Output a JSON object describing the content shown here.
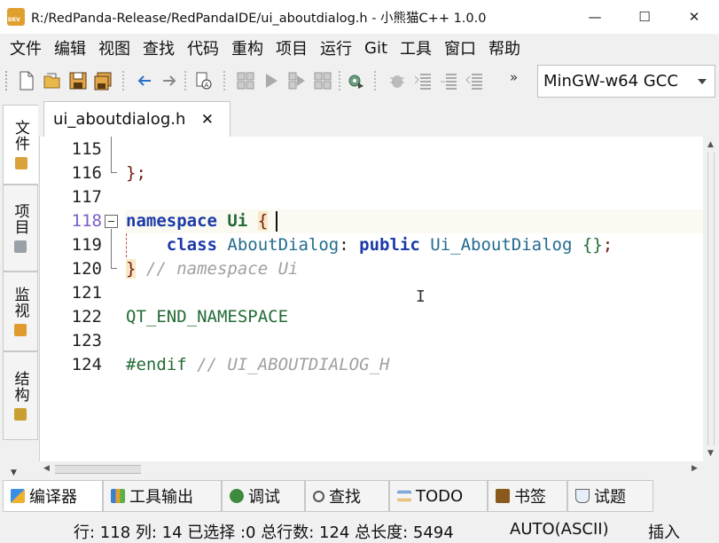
{
  "window": {
    "title": "R:/RedPanda-Release/RedPandaIDE/ui_aboutdialog.h - 小熊猫C++ 1.0.0",
    "minimize_glyph": "—",
    "maximize_glyph": "☐",
    "close_glyph": "✕"
  },
  "menu": [
    "文件",
    "编辑",
    "视图",
    "查找",
    "代码",
    "重构",
    "项目",
    "运行",
    "Git",
    "工具",
    "窗口",
    "帮助"
  ],
  "toolbar": {
    "overflow_glyph": "»",
    "compiler_selected": "MinGW-w64 GCC"
  },
  "left_tabs": [
    "文件",
    "项目",
    "监视",
    "结构"
  ],
  "editor": {
    "tab_label": "ui_aboutdialog.h",
    "tab_close_glyph": "✕",
    "lines": [
      {
        "num": "115"
      },
      {
        "num": "116",
        "brace": "}",
        "semi": ";"
      },
      {
        "num": "117"
      },
      {
        "num": "118",
        "kw": "namespace",
        "name": "Ui",
        "open": "{"
      },
      {
        "num": "119",
        "kw_class": "class",
        "cls": "AboutDialog",
        "colon": ":",
        "kw_public": "public",
        "base": "Ui_AboutDialog",
        "body": "{}",
        "semi": ";"
      },
      {
        "num": "120",
        "close": "}",
        "comment": "// namespace Ui"
      },
      {
        "num": "121"
      },
      {
        "num": "122",
        "macro": "QT_END_NAMESPACE"
      },
      {
        "num": "123"
      },
      {
        "num": "124",
        "directive": "#endif",
        "comment": "// UI_ABOUTDIALOG_H"
      }
    ]
  },
  "bottom_tabs": [
    "编译器",
    "工具输出",
    "调试",
    "查找",
    "TODO",
    "书签",
    "试题"
  ],
  "status": {
    "position": "行: 118 列: 14 已选择 :0 总行数: 124 总长度: 5494",
    "encoding": "AUTO(ASCII)",
    "mode": "插入"
  },
  "colors": {
    "keyword": "#1c3aa9",
    "namespace": "#236b36",
    "comment": "#a0a0a0",
    "current_line_number": "#7a5cc7"
  }
}
